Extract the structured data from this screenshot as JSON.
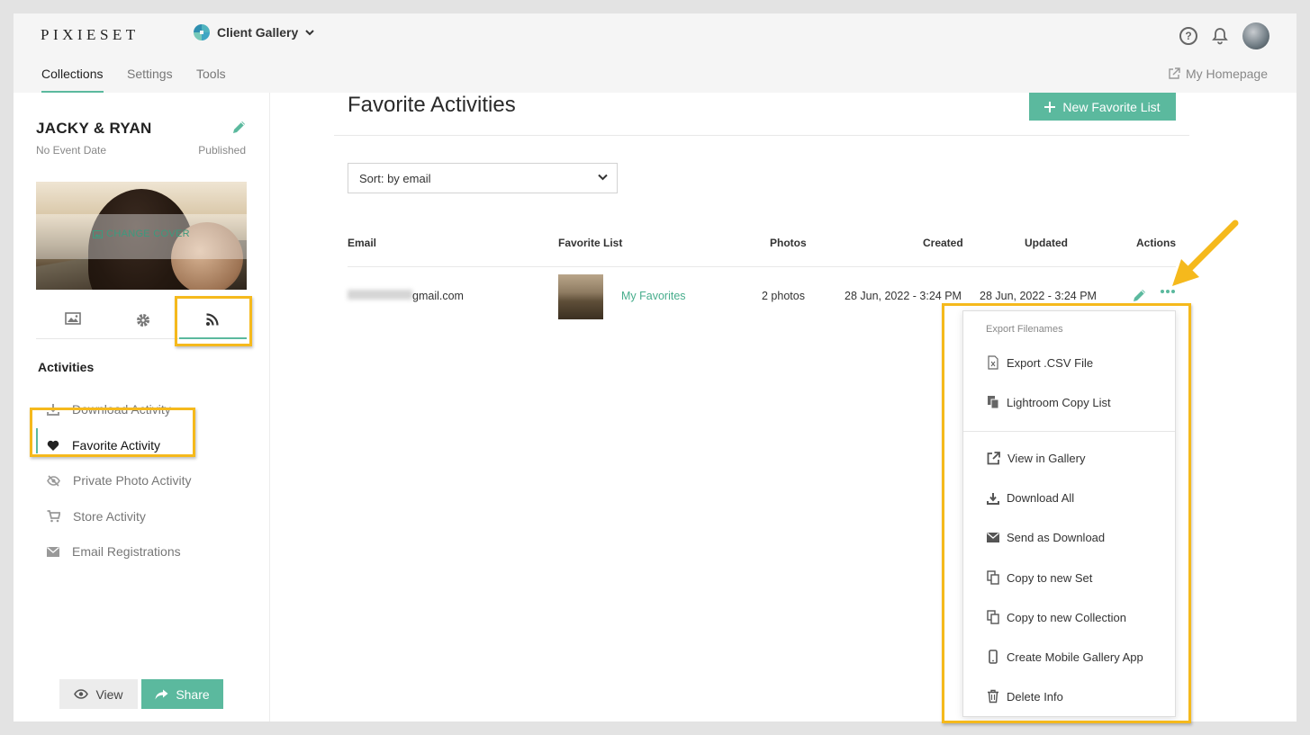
{
  "header": {
    "logo": "PIXIESET",
    "app_name": "Client Gallery"
  },
  "nav": {
    "tabs": [
      "Collections",
      "Settings",
      "Tools"
    ],
    "my_homepage": "My Homepage"
  },
  "sidebar": {
    "collection_title": "JACKY & RYAN",
    "event_date": "No Event Date",
    "status": "Published",
    "change_cover": "CHANGE COVER",
    "activities_title": "Activities",
    "activities": [
      {
        "label": "Download Activity",
        "icon": "download-icon"
      },
      {
        "label": "Favorite Activity",
        "icon": "heart-icon"
      },
      {
        "label": "Private Photo Activity",
        "icon": "eye-slash-icon"
      },
      {
        "label": "Store Activity",
        "icon": "cart-icon"
      },
      {
        "label": "Email Registrations",
        "icon": "envelope-icon"
      }
    ],
    "view_button": "View",
    "share_button": "Share"
  },
  "main": {
    "title": "Favorite Activities",
    "new_button": "New Favorite List",
    "sort_value": "Sort: by email",
    "columns": [
      "Email",
      "Favorite List",
      "Photos",
      "Created",
      "Updated",
      "Actions"
    ],
    "rows": [
      {
        "email": "gmail.com",
        "favorite_list": "My Favorites",
        "photos": "2 photos",
        "created": "28 Jun, 2022 - 3:24 PM",
        "updated": "28 Jun, 2022 - 3:24 PM"
      }
    ]
  },
  "actions_menu": {
    "header": "Export Filenames",
    "export_items": [
      {
        "label": "Export .CSV File",
        "icon": "file-csv-icon"
      },
      {
        "label": "Lightroom Copy List",
        "icon": "copy-files-icon"
      }
    ],
    "items": [
      {
        "label": "View in Gallery",
        "icon": "external-link-icon"
      },
      {
        "label": "Download All",
        "icon": "download-icon"
      },
      {
        "label": "Send as Download",
        "icon": "envelope-icon"
      },
      {
        "label": "Copy to new Set",
        "icon": "copy-icon"
      },
      {
        "label": "Copy to new Collection",
        "icon": "copy-icon"
      },
      {
        "label": "Create Mobile Gallery App",
        "icon": "mobile-icon"
      },
      {
        "label": "Delete Info",
        "icon": "trash-icon"
      }
    ]
  },
  "colors": {
    "accent": "#5bb99e",
    "highlight": "#f5b91c",
    "background": "#e3e3e3"
  }
}
